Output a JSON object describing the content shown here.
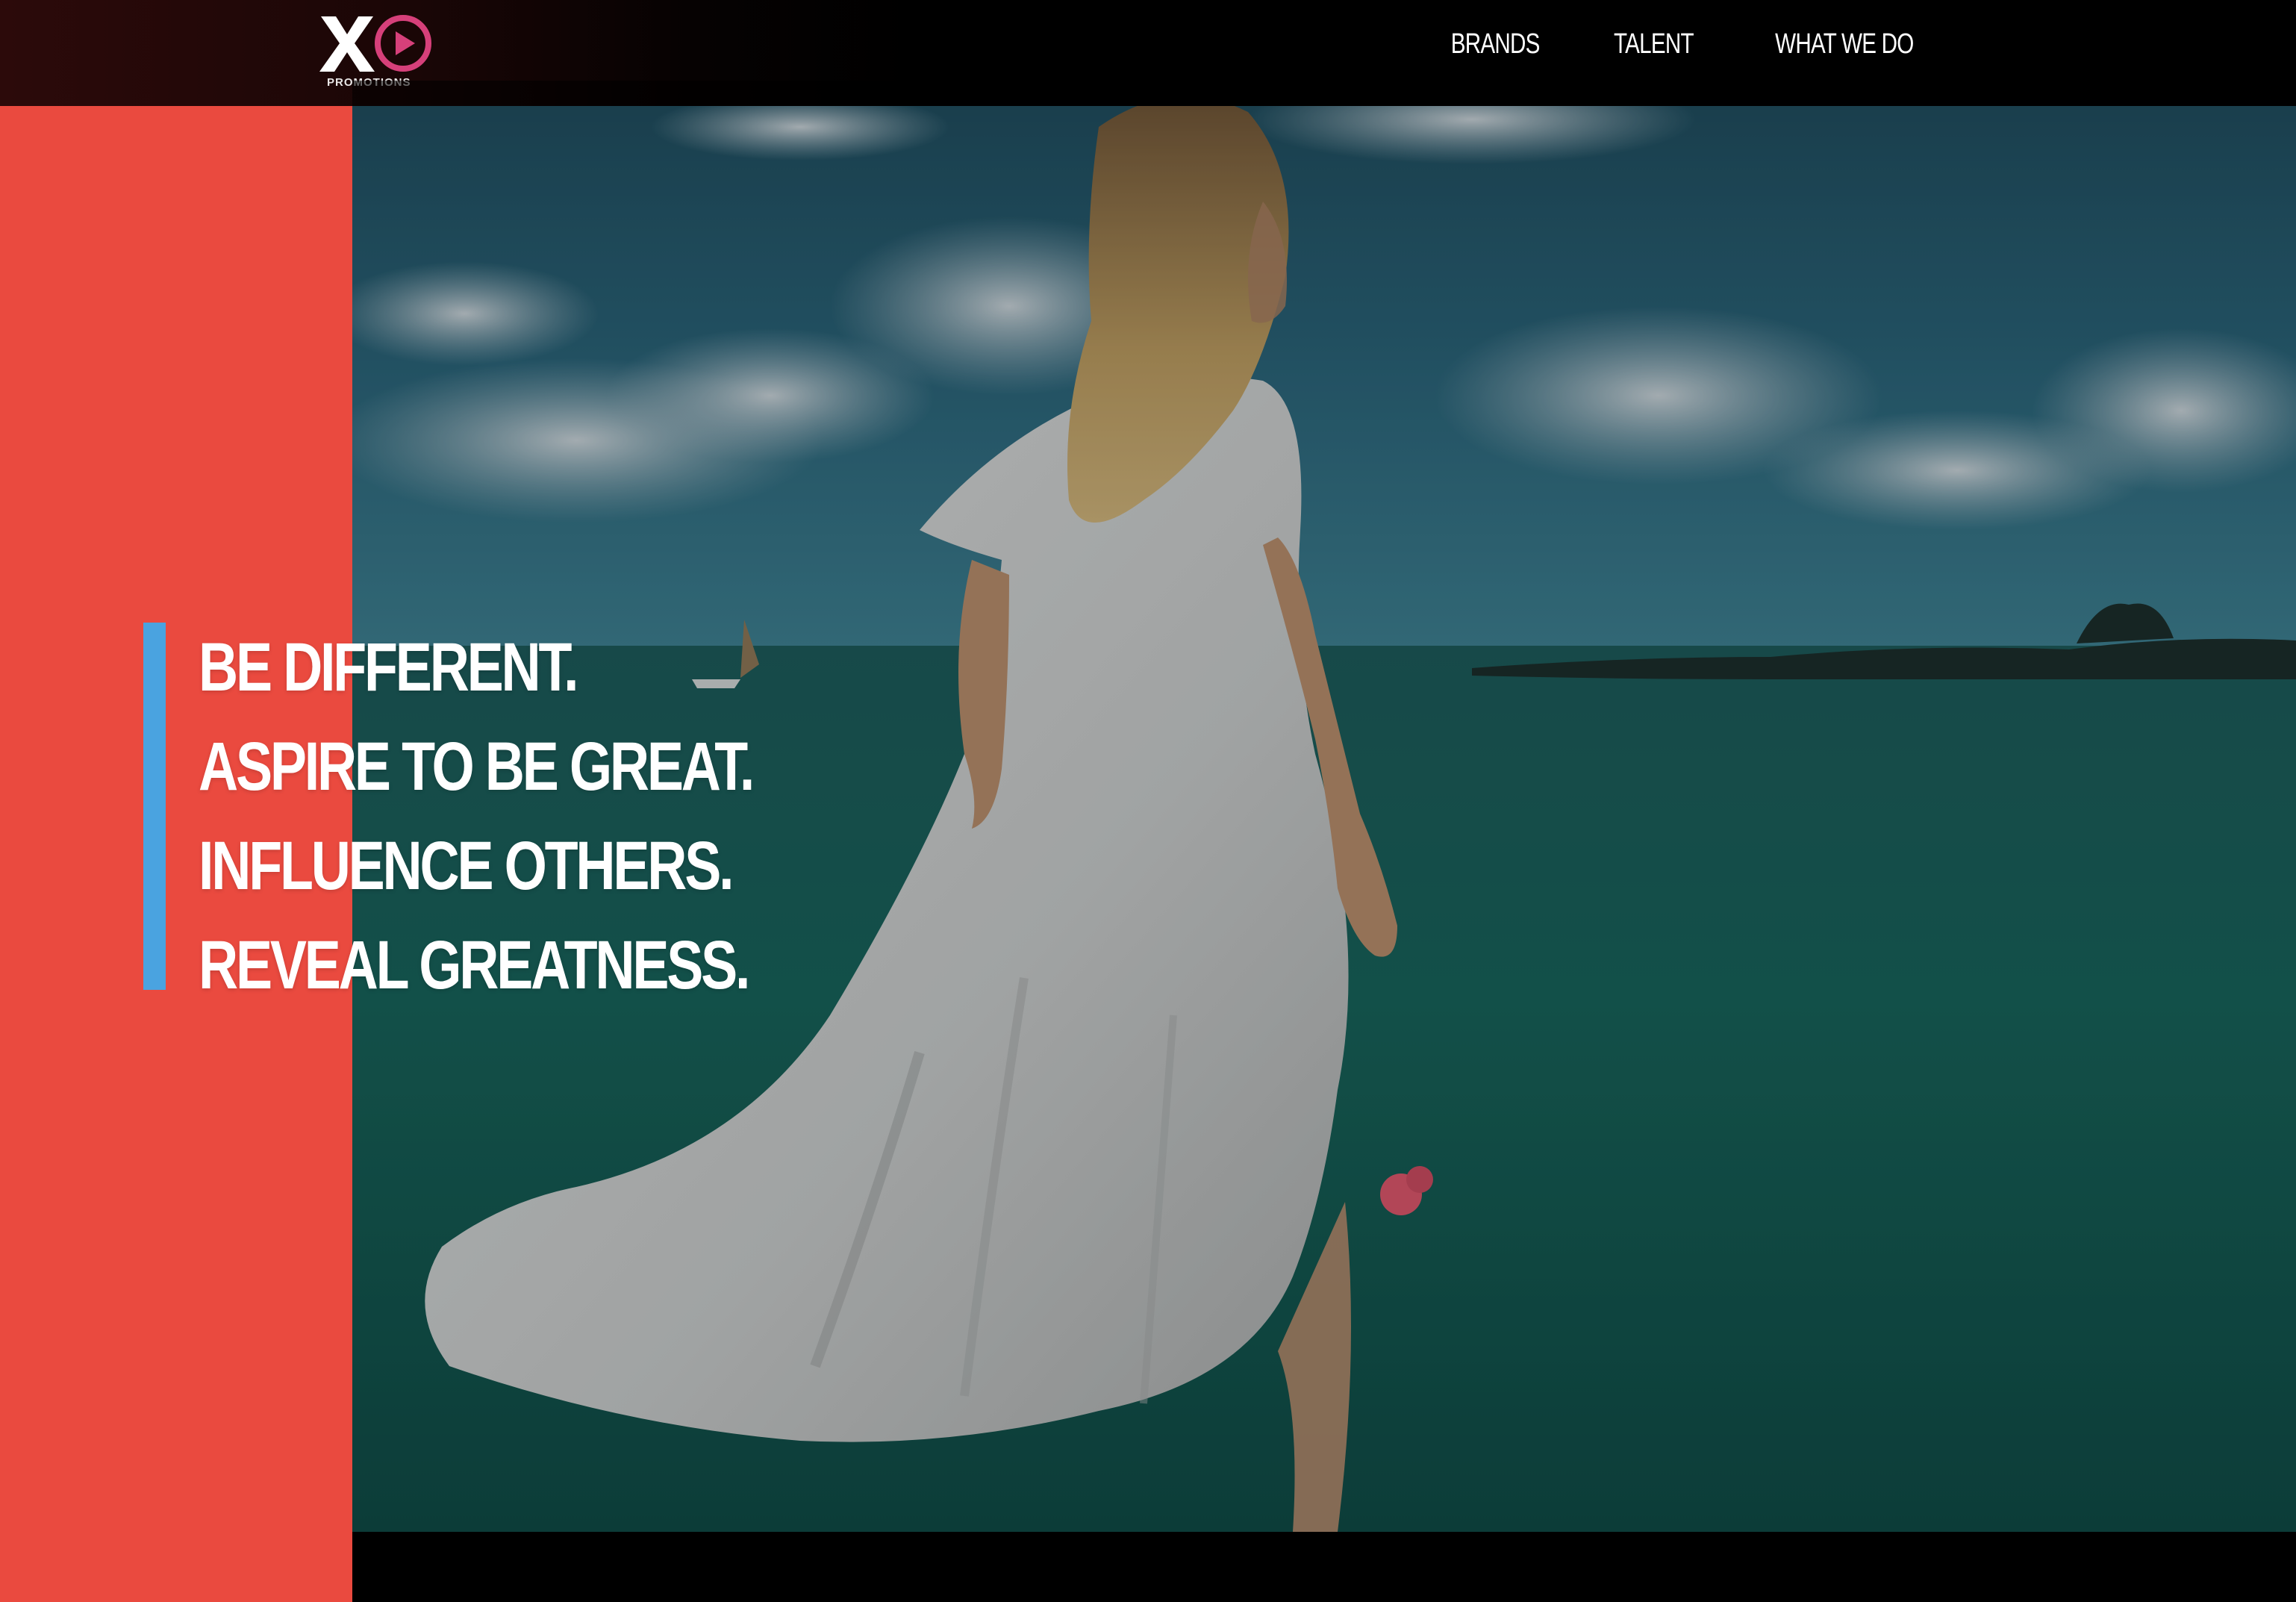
{
  "brand": {
    "logo_text": "XO",
    "logo_subtext": "PROMOTIONS",
    "logo_icon": "play-circle-icon",
    "accent_color": "#d6407a"
  },
  "nav": {
    "items": [
      {
        "label": "BRANDS"
      },
      {
        "label": "TALENT"
      },
      {
        "label": "WHAT WE DO"
      }
    ]
  },
  "hero": {
    "tagline": [
      "BE DIFFERENT.",
      "ASPIRE TO BE GREAT.",
      "INFLUENCE OTHERS.",
      "REVEAL GREATNESS."
    ],
    "background": "video-frame-woman-white-dress-by-sea"
  },
  "colors": {
    "panel_red": "#ea4a3f",
    "tagline_bar_blue": "#4aa3e0",
    "nav_bg": "#000000",
    "text": "#ffffff"
  }
}
